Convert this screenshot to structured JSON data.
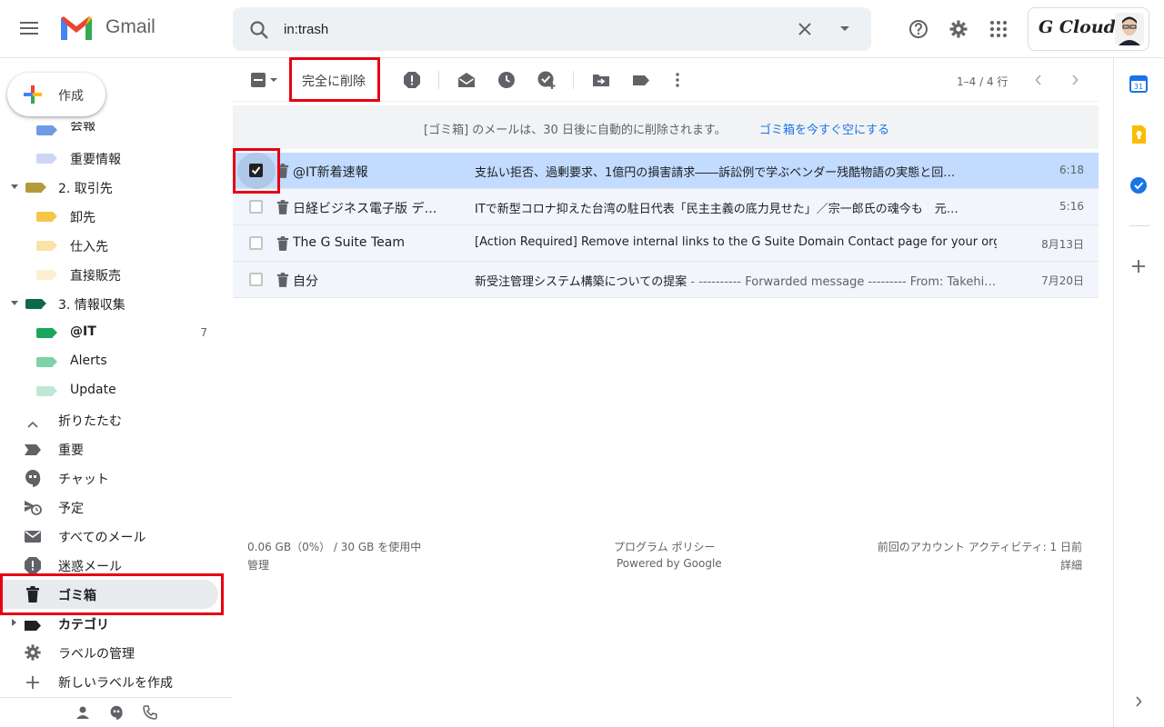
{
  "header": {
    "app_name": "Gmail",
    "search_value": "in:trash",
    "brand_text": "G Cloud"
  },
  "compose": {
    "label": "作成"
  },
  "sidebar": {
    "items": [
      {
        "label": "会報",
        "tag_color": "#6e9ae6"
      },
      {
        "label": "重要情報",
        "tag_color": "#cdd7f5"
      },
      {
        "label": "2. 取引先",
        "tag_color": "#b59a3a"
      },
      {
        "label": "卸先",
        "tag_color": "#f6c54a"
      },
      {
        "label": "仕入先",
        "tag_color": "#fbe3a6"
      },
      {
        "label": "直接販売",
        "tag_color": "#fdf0d0"
      },
      {
        "label": "3. 情報収集",
        "tag_color": "#0b6b47"
      },
      {
        "label": "@IT",
        "count": "7",
        "tag_color": "#1aa55c"
      },
      {
        "label": "Alerts",
        "tag_color": "#7fd1a8"
      },
      {
        "label": "Update",
        "tag_color": "#bde9d4"
      },
      {
        "label": "折りたたむ"
      },
      {
        "label": "重要"
      },
      {
        "label": "チャット"
      },
      {
        "label": "予定"
      },
      {
        "label": "すべてのメール"
      },
      {
        "label": "迷惑メール"
      },
      {
        "label": "ゴミ箱"
      },
      {
        "label": "カテゴリ"
      },
      {
        "label": "ラベルの管理"
      },
      {
        "label": "新しいラベルを作成"
      }
    ]
  },
  "toolbar": {
    "delete_forever_label": "完全に削除",
    "pagination": "1–4 / 4 行"
  },
  "banner": {
    "text": "[ゴミ箱] のメールは、30 日後に自動的に削除されます。",
    "link": "ゴミ箱を今すぐ空にする"
  },
  "emails": [
    {
      "from": "@IT新着速報",
      "subject": "支払い拒否、過剰要求、1億円の損害請求――訴訟例で学ぶベンダー残酷物語の実態と回…",
      "snippet": "",
      "date": "6:18",
      "selected": true
    },
    {
      "from": "日経ビジネス電子版 デ…",
      "subject": "ITで新型コロナ抑えた台湾の駐日代表「民主主義の底力見せた」／宗一郎氏の魂今も　元…",
      "snippet": "",
      "date": "5:16",
      "selected": false
    },
    {
      "from": "The G Suite Team",
      "subject": "[Action Required] Remove internal links to the G Suite Domain Contact page for your org…",
      "snippet": "",
      "date": "8月13日",
      "selected": false
    },
    {
      "from": "自分",
      "subject": "新受注管理システム構築についての提案",
      "snippet": " - ---------- Forwarded message --------- From: Takehi…",
      "date": "7月20日",
      "selected": false
    }
  ],
  "footer": {
    "storage": "0.06 GB（0%） / 30 GB を使用中",
    "manage": "管理",
    "policy": "プログラム ポリシー",
    "powered": "Powered by Google",
    "activity": "前回のアカウント アクティビティ: 1 日前",
    "details": "詳細"
  },
  "colors": {
    "selected_row": "#c2dbff",
    "highlight_red": "#e60012",
    "link_blue": "#1a73e8"
  }
}
